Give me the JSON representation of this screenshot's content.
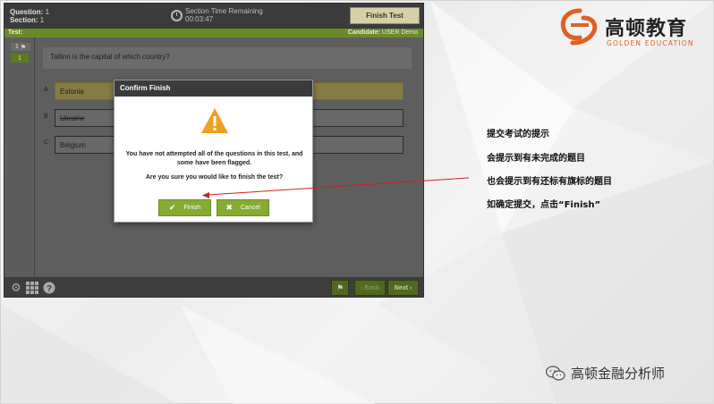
{
  "exam": {
    "question_label": "Question:",
    "question_value": "1",
    "section_label": "Section:",
    "section_value": "1",
    "time_label": "Section Time Remaining",
    "time_value": "00:03:47",
    "finish_test_label": "Finish Test",
    "test_label": "Test:",
    "candidate_label": "Candidate:",
    "candidate_value": "USER Demo",
    "qnav_flag": "1",
    "qnav_box": "1",
    "question_text": "Tallinn is the capital of which country?",
    "options": [
      {
        "letter": "A",
        "text": "Estonia",
        "selected": true,
        "struck": false
      },
      {
        "letter": "B",
        "text": "Ukraine",
        "selected": false,
        "struck": true
      },
      {
        "letter": "C",
        "text": "Belgium",
        "selected": false,
        "struck": false
      }
    ],
    "back_label": "Back",
    "next_label": "Next"
  },
  "modal": {
    "title": "Confirm Finish",
    "message": "You have not attempted all of the questions in this test, and some have been flagged.",
    "question": "Are you sure you would like to finish the test?",
    "finish_label": "Finish",
    "cancel_label": "Cancel"
  },
  "annotations": [
    "提交考试的提示",
    "会提示到有未完成的题目",
    "也会提示到有还标有旗标的题目",
    "如确定提交，点击“Finish”"
  ],
  "logo": {
    "name_cn": "高顿教育",
    "name_en": "GOLDEN EDUCATION"
  },
  "watermark": {
    "text": "高顿金融分析师"
  },
  "colors": {
    "accent_green": "#86ab32",
    "warning_orange": "#f0a020",
    "brand_orange": "#e06020",
    "arrow_red": "#d02020"
  }
}
